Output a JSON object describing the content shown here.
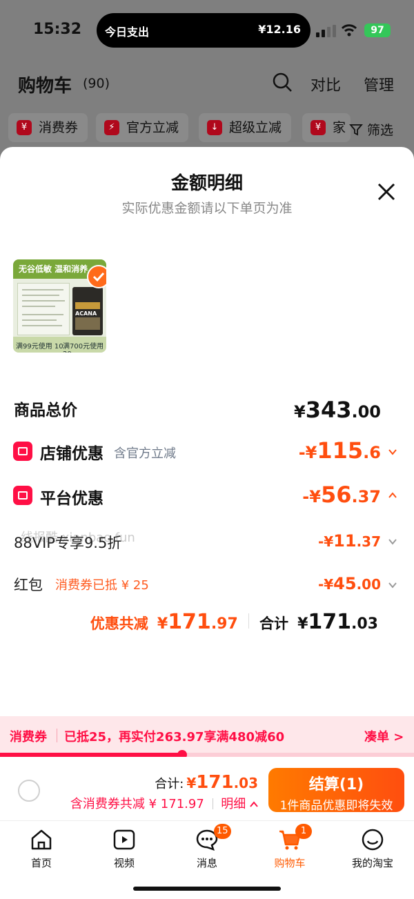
{
  "status": {
    "time": "15:32",
    "island_left": "今日支出",
    "island_right": "¥12.16",
    "battery": "97"
  },
  "header": {
    "title": "购物车",
    "count": "(90)",
    "compare": "对比",
    "manage": "管理"
  },
  "chips": [
    {
      "icon": "¥",
      "label": "消费券"
    },
    {
      "icon": "⚡",
      "label": "官方立减"
    },
    {
      "icon": "↓",
      "label": "超级立减"
    },
    {
      "icon": "¥",
      "label": "家"
    }
  ],
  "filter": "筛选",
  "sheet": {
    "title": "金额明细",
    "subtitle": "实际优惠金额请以下单页为准",
    "product": {
      "banner": "无谷低敏 温和消养",
      "brand": "ACANA",
      "coupon1": "满99元使用 10",
      "coupon2": "满700元使用 20"
    },
    "total_price": {
      "label": "商品总价",
      "symbol": "¥",
      "int": "343",
      "dec": ".00"
    },
    "shop_discount": {
      "label": "店铺优惠",
      "note": "含官方立减",
      "prefix": "-¥",
      "int": "115",
      "dec": ".6"
    },
    "platform_discount": {
      "label": "平台优惠",
      "prefix": "-¥",
      "int": "56",
      "dec": ".37"
    },
    "vip": {
      "label": "88VIP专享9.5折",
      "prefix": "-¥",
      "int": "11",
      "dec": ".37"
    },
    "redpack": {
      "label": "红包",
      "note": "消费券已抵 ¥ 25",
      "prefix": "-¥",
      "int": "45",
      "dec": ".00"
    },
    "summary": {
      "saved_label": "优惠共减",
      "saved_symbol": "¥",
      "saved_int": "171",
      "saved_dec": ".97",
      "total_label": "合计",
      "total_symbol": "¥",
      "total_int": "171",
      "total_dec": ".03"
    },
    "watermark": "线报酷 xianbao.fun"
  },
  "coupon_bar": {
    "tag": "消费券",
    "text": "已抵25，再实付263.97享满480减60",
    "action": "凑单 >",
    "progress": 0.44
  },
  "checkout": {
    "total_label": "合计:",
    "total_symbol": "¥",
    "total_int": "171",
    "total_dec": ".03",
    "savings": "含消费券共减 ¥ 171.97",
    "detail": "明细",
    "button": "结算(1)",
    "button_sub": "1件商品优惠即将失效"
  },
  "tabs": [
    {
      "label": "首页",
      "icon": "home-icon"
    },
    {
      "label": "视频",
      "icon": "video-icon"
    },
    {
      "label": "消息",
      "icon": "message-icon",
      "badge": "15"
    },
    {
      "label": "购物车",
      "icon": "cart-icon",
      "badge": "1",
      "active": true
    },
    {
      "label": "我的淘宝",
      "icon": "profile-icon"
    }
  ],
  "colors": {
    "accent_orange": "#ff4e0f",
    "accent_red": "#ff0f45",
    "overlay": "#7f7f7f"
  }
}
